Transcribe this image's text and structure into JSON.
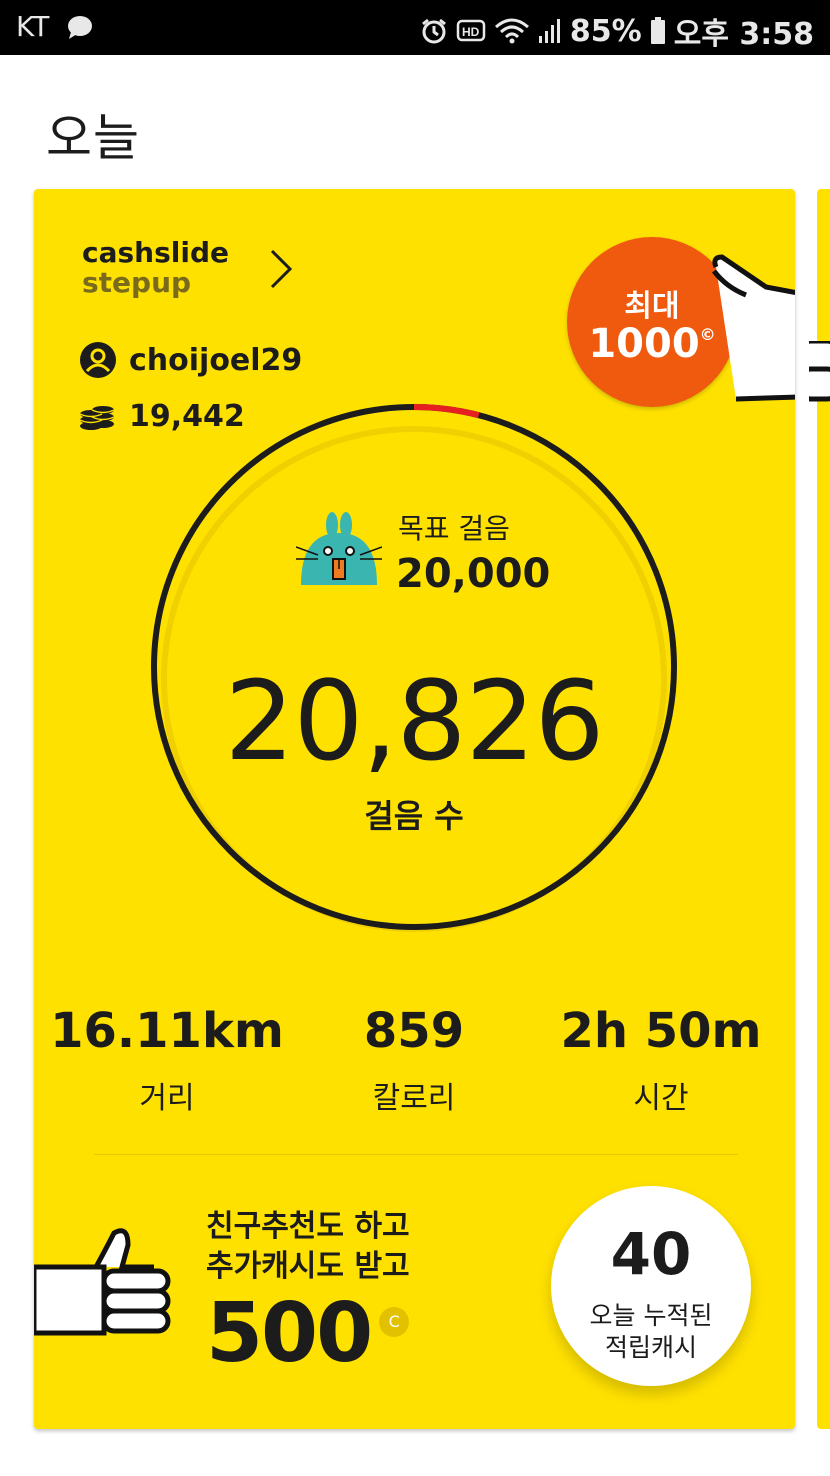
{
  "status_bar": {
    "carrier": "KT",
    "battery": "85%",
    "time": "오후 3:58",
    "icons": [
      "message-bubble-icon",
      "alarm-icon",
      "hd-icon",
      "wifi-icon",
      "signal-icon",
      "battery-icon"
    ]
  },
  "page": {
    "title": "오늘"
  },
  "card": {
    "brand_line1": "cashslide",
    "brand_line2": "stepup",
    "username": "choijoel29",
    "coins": "19,442",
    "max_badge": {
      "label": "최대",
      "value": "1000",
      "unit_symbol": "©"
    },
    "goal": {
      "label": "목표 걸음",
      "value": "20,000"
    },
    "steps": {
      "value": "20,826",
      "label": "걸음 수",
      "progress": 1.04
    },
    "stats": [
      {
        "value": "16.11km",
        "label": "거리"
      },
      {
        "value": "859",
        "label": "칼로리"
      },
      {
        "value": "2h 50m",
        "label": "시간"
      }
    ],
    "promo": {
      "line1": "친구추천도 하고",
      "line2": "추가캐시도 받고",
      "amount": "500",
      "coin_symbol": "C"
    },
    "accumulated": {
      "value": "40",
      "label_line1": "오늘 누적된",
      "label_line2": "적립캐시"
    }
  },
  "colors": {
    "card_bg": "#ffe100",
    "badge_orange": "#f05a0f",
    "ring": "#1c1c1c",
    "ring_overflow": "#e62020",
    "mascot": "#3ab5b0"
  }
}
